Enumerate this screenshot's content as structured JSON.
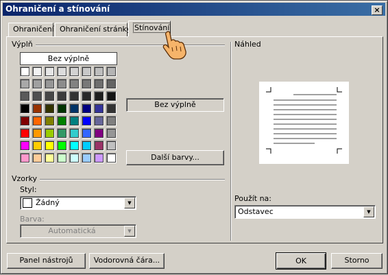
{
  "window": {
    "title": "Ohraničení a stínování",
    "close_label": "×"
  },
  "tabs": [
    {
      "label": "Ohraničení"
    },
    {
      "label": "Ohraničení stránky"
    },
    {
      "label": "Stínování"
    }
  ],
  "fill": {
    "group_label": "Výplň",
    "no_fill_label": "Bez výplně",
    "selected_label": "Bez výplně",
    "more_colors_label": "Další barvy..."
  },
  "palette": [
    [
      "#ffffff",
      "#f2f2f2",
      "#e6e6e6",
      "#dcdcdc",
      "#d2d2d2",
      "#c8c8c8",
      "#bebebe",
      "#b4b4b4"
    ],
    [
      "#a8a8a8",
      "#a0a0a0",
      "#969696",
      "#8c8c8c",
      "#828282",
      "#787878",
      "#6e6e6e",
      "#646464"
    ],
    [
      "#5a5a5a",
      "#505050",
      "#464646",
      "#3c3c3c",
      "#323232",
      "#282828",
      "#1e1e1e",
      "#141414"
    ],
    [
      "#000000",
      "#993300",
      "#333300",
      "#003300",
      "#003366",
      "#000080",
      "#333399",
      "#333333"
    ],
    [
      "#800000",
      "#ff6600",
      "#808000",
      "#008000",
      "#008080",
      "#0000ff",
      "#666699",
      "#808080"
    ],
    [
      "#ff0000",
      "#ff9900",
      "#99cc00",
      "#339966",
      "#33cccc",
      "#3366ff",
      "#800080",
      "#969696"
    ],
    [
      "#ff00ff",
      "#ffcc00",
      "#ffff00",
      "#00ff00",
      "#00ffff",
      "#00ccff",
      "#993366",
      "#c0c0c0"
    ],
    [
      "#ff99cc",
      "#ffcc99",
      "#ffff99",
      "#ccffcc",
      "#ccffff",
      "#99ccff",
      "#cc99ff",
      "#ffffff"
    ]
  ],
  "patterns": {
    "group_label": "Vzorky",
    "style_label": "Styl:",
    "style_value": "Žádný",
    "color_label": "Barva:",
    "color_value": "Automatická"
  },
  "preview": {
    "group_label": "Náhled",
    "apply_label": "Použít na:",
    "apply_value": "Odstavec"
  },
  "footer": {
    "toolbar_label": "Panel nástrojů",
    "hline_label": "Vodorovná čára...",
    "ok_label": "OK",
    "cancel_label": "Storno"
  }
}
